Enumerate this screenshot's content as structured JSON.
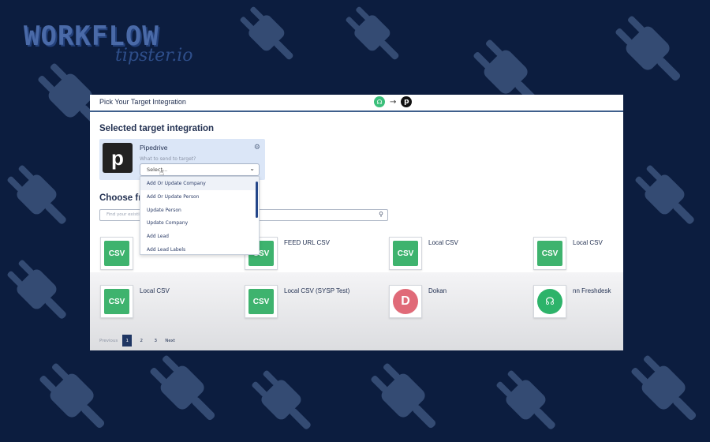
{
  "brand": {
    "name": "WORKFLOW",
    "tagline": "tipster.io"
  },
  "app": {
    "header_title": "Pick Your Target Integration",
    "flow_source_icon": "headset-icon",
    "flow_target_icon": "pipedrive-logo",
    "section_title": "Selected target integration",
    "selected": {
      "name": "Pipedrive",
      "hint": "What to send to target?",
      "logo_letter": "p",
      "select_value": "Select..."
    },
    "dropdown_options": [
      "Add Or Update Company",
      "Add Or Update Person",
      "Update Person",
      "Update Company",
      "Add Lead",
      "Add Lead Labels"
    ],
    "choose_title": "Choose fro",
    "search_placeholder": "Find your existing",
    "tiles": [
      {
        "name": "FEED URL CSV",
        "icon": "csv",
        "label": "CSV"
      },
      {
        "name": "Local CSV",
        "icon": "csv",
        "label": "CSV"
      },
      {
        "name": "Local CSV",
        "icon": "csv",
        "label": "CSV"
      },
      {
        "name": "Local CSV",
        "icon": "csv",
        "label": "CSV"
      },
      {
        "name": "Local CSV (SYSP Test)",
        "icon": "csv",
        "label": "CSV"
      },
      {
        "name": "Dokan",
        "icon": "dokan",
        "label": "D"
      },
      {
        "name": "nn Freshdesk",
        "icon": "freshdesk",
        "label": ""
      }
    ],
    "first_tile_label": "CSV",
    "pagination": {
      "previous": "Previous",
      "pages": [
        "1",
        "2",
        "3"
      ],
      "current": "1",
      "next": "Next"
    }
  },
  "colors": {
    "background": "#0c1d3f",
    "accent": "#1f3663",
    "csv_green": "#3eb36e"
  }
}
